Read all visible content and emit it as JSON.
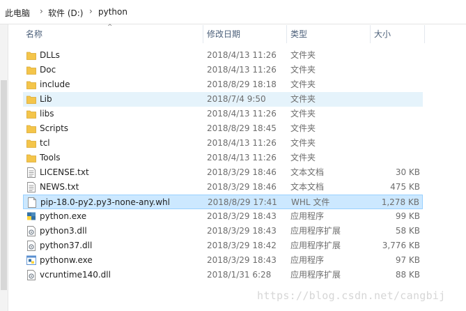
{
  "breadcrumb": [
    "此电脑",
    "软件 (D:)",
    "python"
  ],
  "breadcrumb_separator": "›",
  "columns": {
    "name": "名称",
    "date": "修改日期",
    "type": "类型",
    "size": "大小"
  },
  "sort_indicator": "^",
  "colors": {
    "hover_row": "#e5f3fb",
    "selected_row": "#cce8ff",
    "folder": "#f4c54a"
  },
  "files": [
    {
      "name": "DLLs",
      "date": "2018/4/13 11:26",
      "type": "文件夹",
      "size": "",
      "icon": "folder-icon"
    },
    {
      "name": "Doc",
      "date": "2018/4/13 11:26",
      "type": "文件夹",
      "size": "",
      "icon": "folder-icon"
    },
    {
      "name": "include",
      "date": "2018/8/29 18:18",
      "type": "文件夹",
      "size": "",
      "icon": "folder-icon"
    },
    {
      "name": "Lib",
      "date": "2018/7/4 9:50",
      "type": "文件夹",
      "size": "",
      "icon": "folder-icon",
      "state": "hover"
    },
    {
      "name": "libs",
      "date": "2018/4/13 11:26",
      "type": "文件夹",
      "size": "",
      "icon": "folder-icon"
    },
    {
      "name": "Scripts",
      "date": "2018/8/29 18:45",
      "type": "文件夹",
      "size": "",
      "icon": "folder-icon"
    },
    {
      "name": "tcl",
      "date": "2018/4/13 11:26",
      "type": "文件夹",
      "size": "",
      "icon": "folder-icon"
    },
    {
      "name": "Tools",
      "date": "2018/4/13 11:26",
      "type": "文件夹",
      "size": "",
      "icon": "folder-icon"
    },
    {
      "name": "LICENSE.txt",
      "date": "2018/3/29 18:46",
      "type": "文本文档",
      "size": "30 KB",
      "icon": "text-file-icon"
    },
    {
      "name": "NEWS.txt",
      "date": "2018/3/29 18:46",
      "type": "文本文档",
      "size": "475 KB",
      "icon": "text-file-icon"
    },
    {
      "name": "pip-18.0-py2.py3-none-any.whl",
      "date": "2018/8/29 17:41",
      "type": "WHL 文件",
      "size": "1,278 KB",
      "icon": "blank-file-icon",
      "state": "selected"
    },
    {
      "name": "python.exe",
      "date": "2018/3/29 18:43",
      "type": "应用程序",
      "size": "99 KB",
      "icon": "python-exe-icon"
    },
    {
      "name": "python3.dll",
      "date": "2018/3/29 18:43",
      "type": "应用程序扩展",
      "size": "58 KB",
      "icon": "dll-file-icon"
    },
    {
      "name": "python37.dll",
      "date": "2018/3/29 18:42",
      "type": "应用程序扩展",
      "size": "3,776 KB",
      "icon": "dll-file-icon"
    },
    {
      "name": "pythonw.exe",
      "date": "2018/3/29 18:43",
      "type": "应用程序",
      "size": "97 KB",
      "icon": "pythonw-exe-icon"
    },
    {
      "name": "vcruntime140.dll",
      "date": "2018/1/31 6:28",
      "type": "应用程序扩展",
      "size": "88 KB",
      "icon": "dll-file-icon"
    }
  ],
  "watermark": "https://blog.csdn.net/cangbij"
}
